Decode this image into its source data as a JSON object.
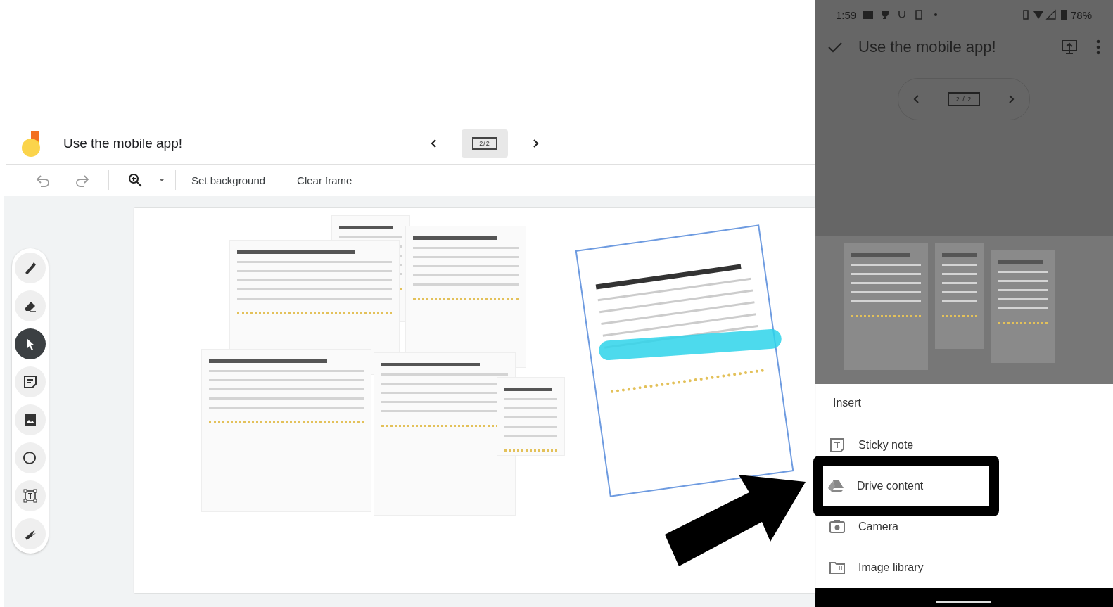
{
  "board": {
    "title": "Use the mobile app!",
    "frame_counter": "2/2"
  },
  "toolbar": {
    "buttons": [
      {
        "label": "Set background"
      },
      {
        "label": "Clear frame"
      }
    ]
  },
  "tools": [
    {
      "kind": "pen",
      "selected": false
    },
    {
      "kind": "eraser",
      "selected": false
    },
    {
      "kind": "select",
      "selected": true
    },
    {
      "kind": "note",
      "selected": false
    },
    {
      "kind": "image",
      "selected": false
    },
    {
      "kind": "shape",
      "selected": false
    },
    {
      "kind": "textbox",
      "selected": false
    },
    {
      "kind": "laser",
      "selected": false
    }
  ],
  "phone": {
    "status_bar": {
      "time": "1:59",
      "battery": "78%"
    },
    "app_bar": {
      "title": "Use the mobile app!"
    },
    "frame_counter": "2 / 2",
    "insert_sheet": {
      "title": "Insert",
      "items": [
        {
          "label": "Sticky note",
          "kind": "sticky",
          "highlighted": false
        },
        {
          "label": "Drive content",
          "kind": "drive",
          "highlighted": true
        },
        {
          "label": "Camera",
          "kind": "camera",
          "highlighted": false
        },
        {
          "label": "Image library",
          "kind": "library",
          "highlighted": false
        }
      ]
    }
  }
}
